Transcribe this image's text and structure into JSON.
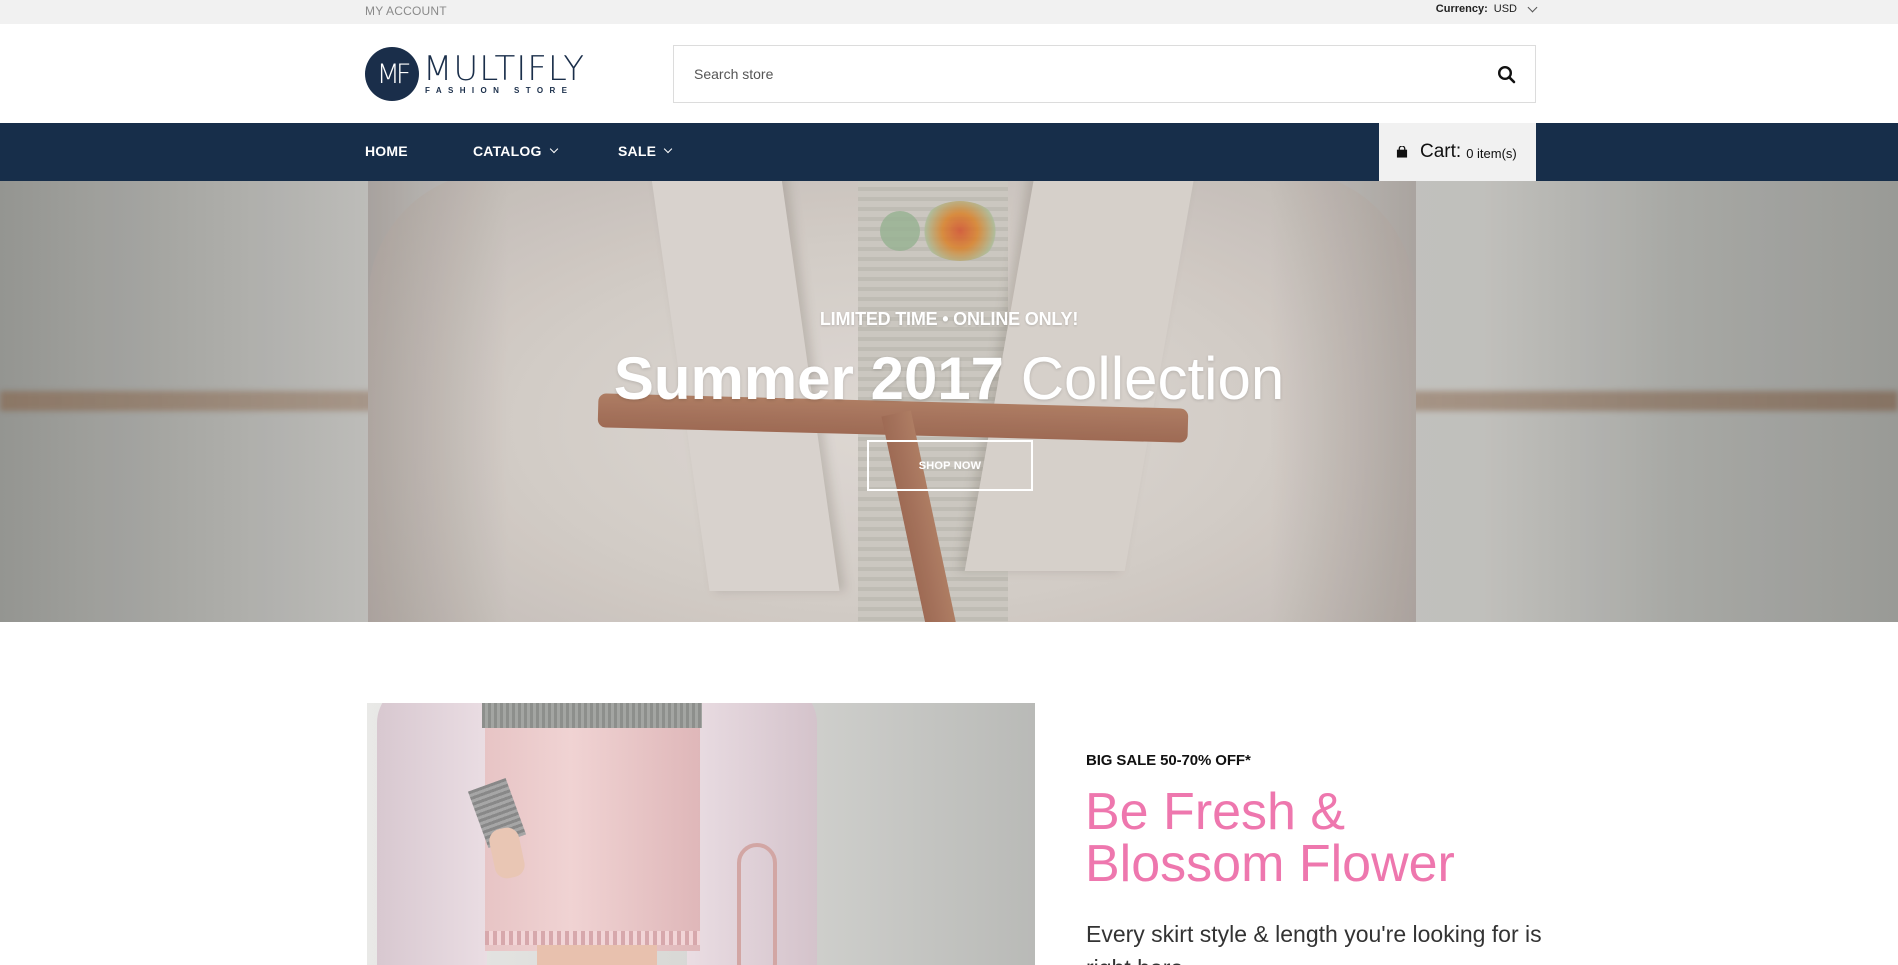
{
  "topbar": {
    "my_account": "MY ACCOUNT",
    "currency_label": "Currency:",
    "currency_value": "USD"
  },
  "header": {
    "logo_mark": "MF",
    "logo_name": "MULTIFLY",
    "logo_tagline": "FASHION STORE",
    "search_placeholder": "Search store",
    "brand_color": "#1a2e4a"
  },
  "nav": {
    "items": [
      {
        "label": "HOME",
        "dropdown": false
      },
      {
        "label": "CATALOG",
        "dropdown": true
      },
      {
        "label": "SALE",
        "dropdown": true
      }
    ],
    "cart_label": "Cart:",
    "cart_count": "0 item(s)",
    "background": "#172e4a"
  },
  "hero": {
    "tagline": "LIMITED TIME • ONLINE ONLY!",
    "title_strong": "Summer 2017",
    "title_light": "Collection",
    "button_label": "SHOP NOW"
  },
  "promo": {
    "tag": "BIG SALE 50-70% OFF*",
    "title": "Be Fresh & Blossom Flower",
    "description": "Every skirt style & length you're looking for is right here.",
    "accent_color": "#ee77ae"
  }
}
